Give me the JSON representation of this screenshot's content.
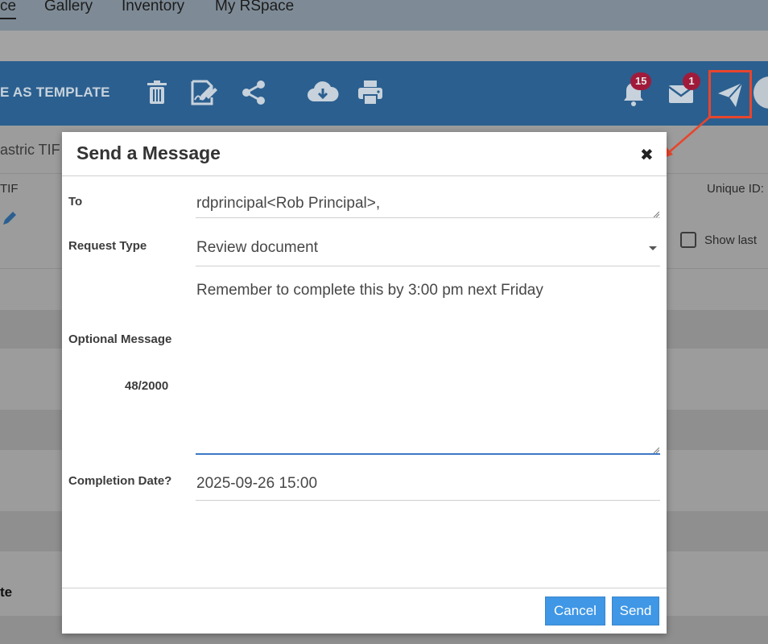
{
  "topnav": {
    "tabs": [
      {
        "label": "ce"
      },
      {
        "label": "Gallery"
      },
      {
        "label": "Inventory"
      },
      {
        "label": "My RSpace"
      }
    ]
  },
  "toolbar": {
    "template_label": "E AS TEMPLATE",
    "notifications_count": "15",
    "messages_count": "1",
    "icons": [
      "trash-icon",
      "sign-icon",
      "share-icon",
      "cloud-download-icon",
      "print-icon",
      "bell-icon",
      "envelope-icon",
      "paper-plane-icon"
    ]
  },
  "background": {
    "crumb": "astric  TIF",
    "tif_label": "TIF",
    "unique_id_label": "Unique ID:",
    "show_last_label": "Show last",
    "partial_text": "te"
  },
  "modal": {
    "title": "Send a Message",
    "close_symbol": "✖",
    "to_label": "To",
    "to_value": "rdprincipal<Rob Principal>,",
    "request_type_label": "Request Type",
    "request_type_value": "Review document",
    "optional_message_label": "Optional Message",
    "message_text": "Remember to complete this by 3:00 pm next Friday",
    "char_count": "48/2000",
    "completion_date_label": "Completion Date?",
    "completion_date_value": "2025-09-26 15:00",
    "cancel_label": "Cancel",
    "send_label": "Send"
  },
  "colors": {
    "toolbar_bg": "#2b5f8f",
    "badge_bg": "#a01b3b",
    "button_bg": "#3f97e6",
    "highlight": "#e8452c"
  }
}
